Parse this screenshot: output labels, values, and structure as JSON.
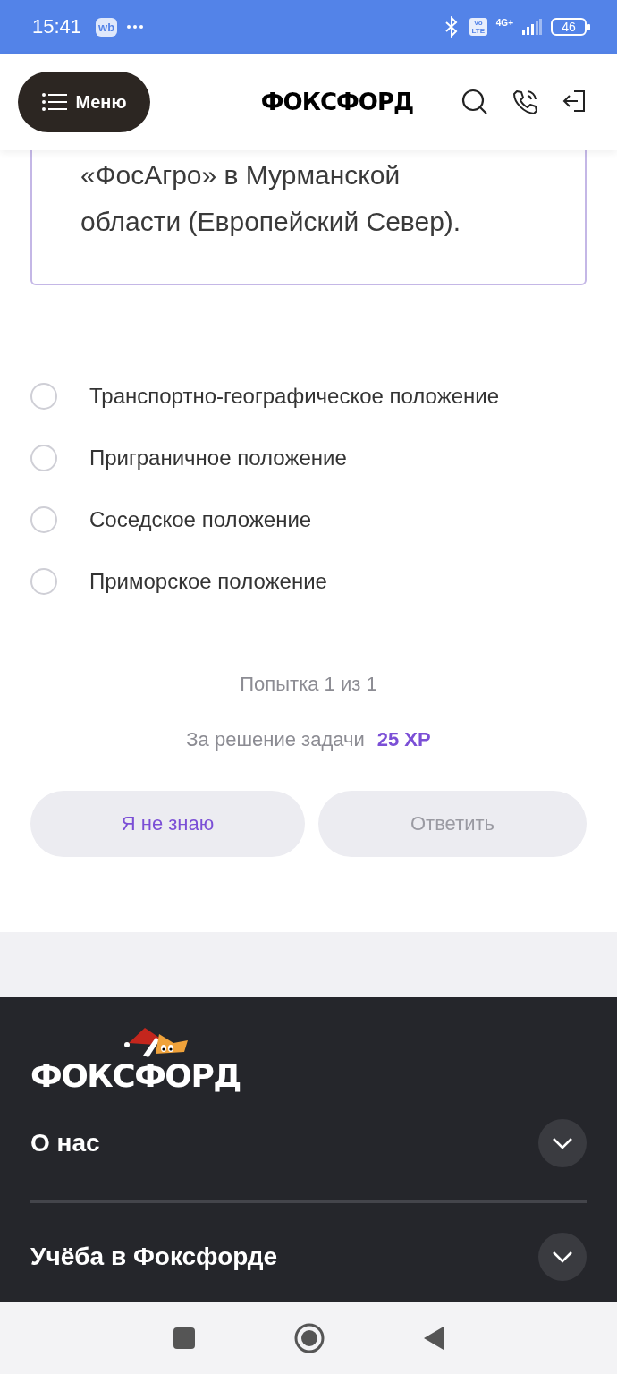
{
  "status_bar": {
    "time": "15:41",
    "app_badge": "wb",
    "volte": "Vo LTE",
    "network": "4G+",
    "battery": "46"
  },
  "header": {
    "menu_label": "Меню",
    "logo": "ФОКСФОРД"
  },
  "question": {
    "text": "«ФосАгро» в Мурманской области (Европейский Север).",
    "options": [
      {
        "label": "Транспортно-географическое положение",
        "selected": false
      },
      {
        "label": "Приграничное положение",
        "selected": false
      },
      {
        "label": "Соседское положение",
        "selected": false
      },
      {
        "label": "Приморское положение",
        "selected": false
      }
    ],
    "attempt": "Попытка 1 из 1",
    "reward_label": "За решение задачи",
    "reward_value": "25 XP",
    "buttons": [
      {
        "label": "Я не знаю",
        "disabled": false
      },
      {
        "label": "Ответить",
        "disabled": true
      }
    ]
  },
  "footer": {
    "logo": "ФОКСФОРД",
    "sections": [
      {
        "title": "О нас",
        "expanded": false
      },
      {
        "title": "Учёба в Фоксфорде",
        "expanded": false
      }
    ]
  }
}
